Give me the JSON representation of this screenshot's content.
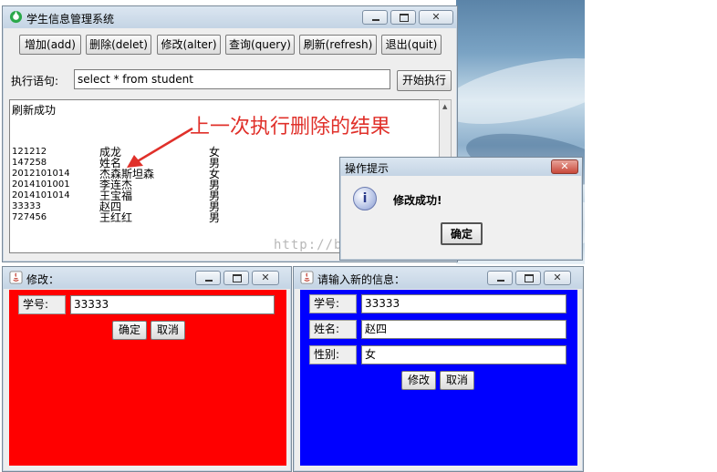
{
  "main_window": {
    "title": "学生信息管理系统",
    "toolbar": {
      "add": "增加(add)",
      "delete": "删除(delet)",
      "alter": "修改(alter)",
      "query": "查询(query)",
      "refresh": "刷新(refresh)",
      "quit": "退出(quit)"
    },
    "exec_label": "执行语句:",
    "exec_value": "select * from student",
    "exec_button": "开始执行",
    "status_text": "刷新成功",
    "records": [
      {
        "id": "121212",
        "name": "成龙",
        "gender": "女"
      },
      {
        "id": "147258",
        "name": "姓名",
        "gender": "男"
      },
      {
        "id": "2012101014",
        "name": "杰森斯坦森",
        "gender": "女"
      },
      {
        "id": "2014101001",
        "name": "李连杰",
        "gender": "男"
      },
      {
        "id": "2014101014",
        "name": "王宝福",
        "gender": "男"
      },
      {
        "id": "33333",
        "name": "赵四",
        "gender": "男"
      },
      {
        "id": "727456",
        "name": "王红红",
        "gender": "男"
      }
    ]
  },
  "annotation": "上一次执行删除的结果",
  "watermark": "http://blog.csdn.net/",
  "dialog": {
    "title": "操作提示",
    "icon_letter": "i",
    "message": "修改成功!",
    "ok": "确定"
  },
  "modify_window": {
    "title": "修改：",
    "id_label": "学号:",
    "id_value": "33333",
    "ok": "确定",
    "cancel": "取消"
  },
  "new_info_window": {
    "title": "请输入新的信息：",
    "id_label": "学号:",
    "id_value": "33333",
    "name_label": "姓名:",
    "name_value": "赵四",
    "gender_label": "性别:",
    "gender_value": "女",
    "modify": "修改",
    "cancel": "取消"
  },
  "colors": {
    "modify_panel": "#ff0000",
    "new_info_panel": "#0000ff",
    "annotation": "#e0302a"
  }
}
